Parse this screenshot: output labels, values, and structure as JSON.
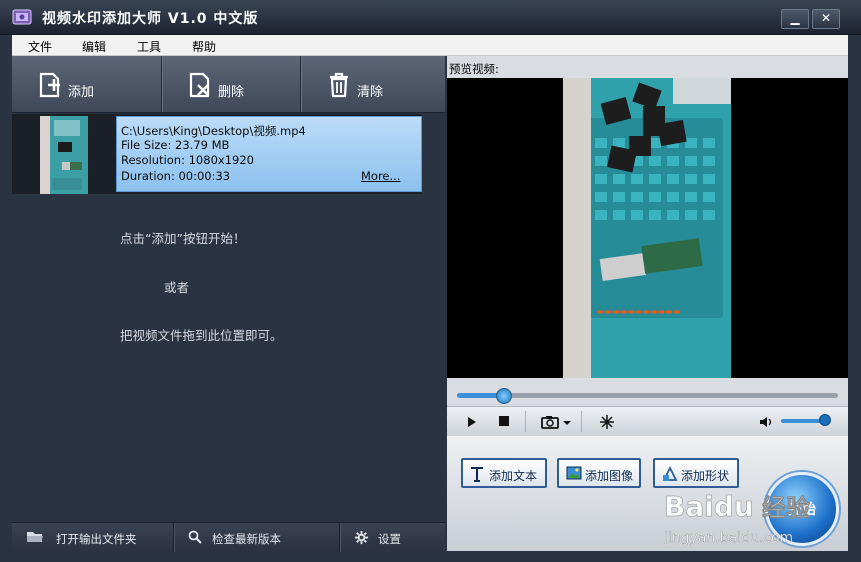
{
  "window": {
    "title": "视频水印添加大师 V1.0 中文版",
    "min_label": "▁",
    "close_label": "✕"
  },
  "menu": [
    "文件",
    "编辑",
    "工具",
    "帮助"
  ],
  "toolbar": {
    "add": "添加",
    "delete": "删除",
    "clear": "清除"
  },
  "file": {
    "path": "C:\\Users\\King\\Desktop\\视频.mp4",
    "size": "File Size: 23.79 MB",
    "resolution": "Resolution: 1080x1920",
    "duration": "Duration: 00:00:33",
    "more": "More..."
  },
  "hints": {
    "line1": "点击“添加”按钮开始！",
    "line2": "或者",
    "line3": "把视频文件拖到此位置即可。"
  },
  "bottom": {
    "open_folder": "打开输出文件夹",
    "check_update": "检查最新版本",
    "settings": "设置"
  },
  "preview": {
    "label": "预览视频:",
    "seek_fraction": 0.12,
    "volume_fraction": 0.9
  },
  "actions": {
    "add_text": "添加文本",
    "add_image": "添加图像",
    "add_shape": "添加形状",
    "start": "开始"
  },
  "watermark": {
    "text1": "Baidu",
    "text2": "经验",
    "text3": "jingyan.baidu.com"
  }
}
